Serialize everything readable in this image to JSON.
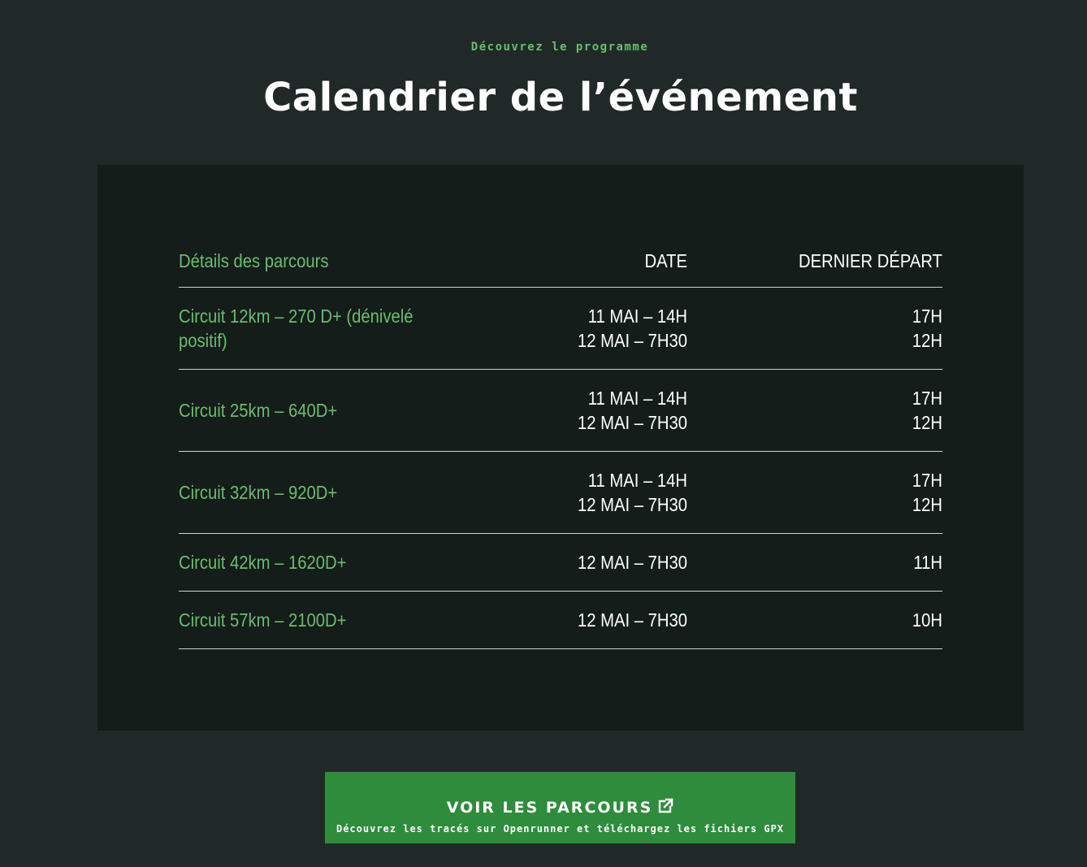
{
  "header": {
    "eyebrow": "Découvrez le programme",
    "title": "Calendrier de l’événement"
  },
  "table": {
    "columns": {
      "name": "Détails des parcours",
      "date": "DATE",
      "depart": "DERNIER DÉPART"
    },
    "rows": [
      {
        "name": "Circuit 12km – 270 D+ (dénivelé positif)",
        "dates": [
          "11 MAI – 14H",
          "12 MAI – 7H30"
        ],
        "departs": [
          "17H",
          "12H"
        ]
      },
      {
        "name": "Circuit 25km – 640D+",
        "dates": [
          "11 MAI – 14H",
          "12 MAI – 7H30"
        ],
        "departs": [
          "17H",
          "12H"
        ]
      },
      {
        "name": "Circuit 32km – 920D+",
        "dates": [
          "11 MAI – 14H",
          "12 MAI – 7H30"
        ],
        "departs": [
          "17H",
          "12H"
        ]
      },
      {
        "name": "Circuit 42km – 1620D+",
        "dates": [
          "12 MAI – 7H30"
        ],
        "departs": [
          "11H"
        ]
      },
      {
        "name": "Circuit 57km – 2100D+",
        "dates": [
          "12 MAI – 7H30"
        ],
        "departs": [
          "10H"
        ]
      }
    ]
  },
  "cta": {
    "label": "VOIR LES PARCOURS",
    "icon": "external-link-icon",
    "sublabel": "Découvrez les tracés sur Openrunner et téléchargez les fichiers GPX"
  },
  "colors": {
    "page_background": "#212928",
    "panel_background": "#141d1a",
    "accent_green": "#6bbd6e",
    "button_green": "#2e8c3c",
    "divider": "#cfd3d1"
  }
}
